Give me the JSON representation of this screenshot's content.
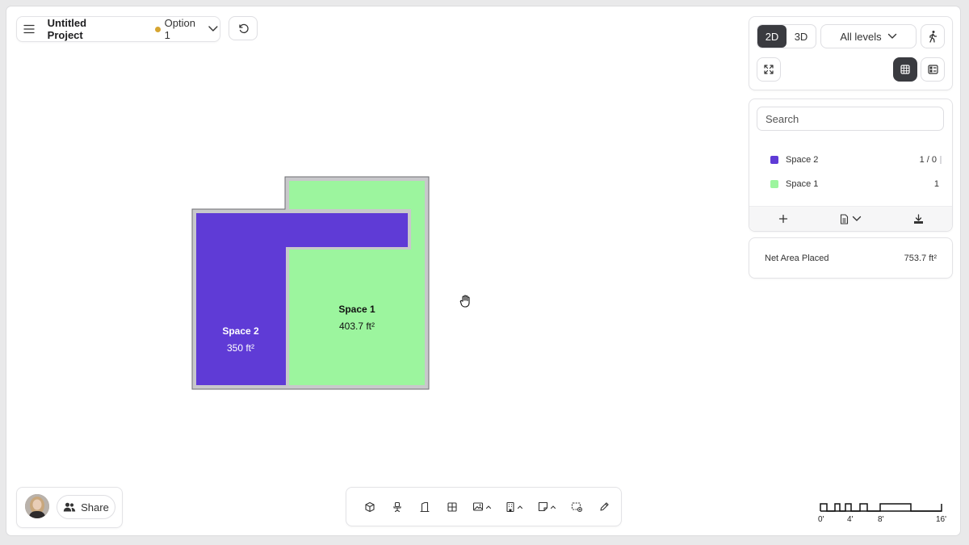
{
  "project": {
    "title": "Untitled Project",
    "option_label": "Option 1",
    "option_dot_color": "#d6a531"
  },
  "view": {
    "mode_2d": "2D",
    "mode_3d": "3D",
    "active_mode": "2D",
    "levels_label": "All levels"
  },
  "search": {
    "placeholder": "Search"
  },
  "spaces": [
    {
      "name": "Space 2",
      "count": "1 / 0",
      "color": "#5f3bd6"
    },
    {
      "name": "Space 1",
      "count": "1",
      "color": "#9cf59e"
    }
  ],
  "area": {
    "label": "Net Area Placed",
    "value": "753.7 ft²"
  },
  "plan": {
    "rooms": [
      {
        "name": "Space 2",
        "area": "350 ft²",
        "color": "#5f3bd6"
      },
      {
        "name": "Space 1",
        "area": "403.7 ft²",
        "color": "#9cf59e"
      }
    ]
  },
  "share": {
    "label": "Share"
  },
  "scale": {
    "ticks": [
      "0'",
      "4'",
      "8'",
      "16'"
    ]
  },
  "icons": {
    "menu": "menu-icon",
    "undo": "undo-icon",
    "walk": "walk-icon",
    "fit": "fit-view-icon",
    "grid": "grid-view-icon",
    "list": "list-view-icon",
    "add": "plus-icon",
    "doc": "document-icon",
    "download": "download-icon",
    "users": "users-icon"
  }
}
